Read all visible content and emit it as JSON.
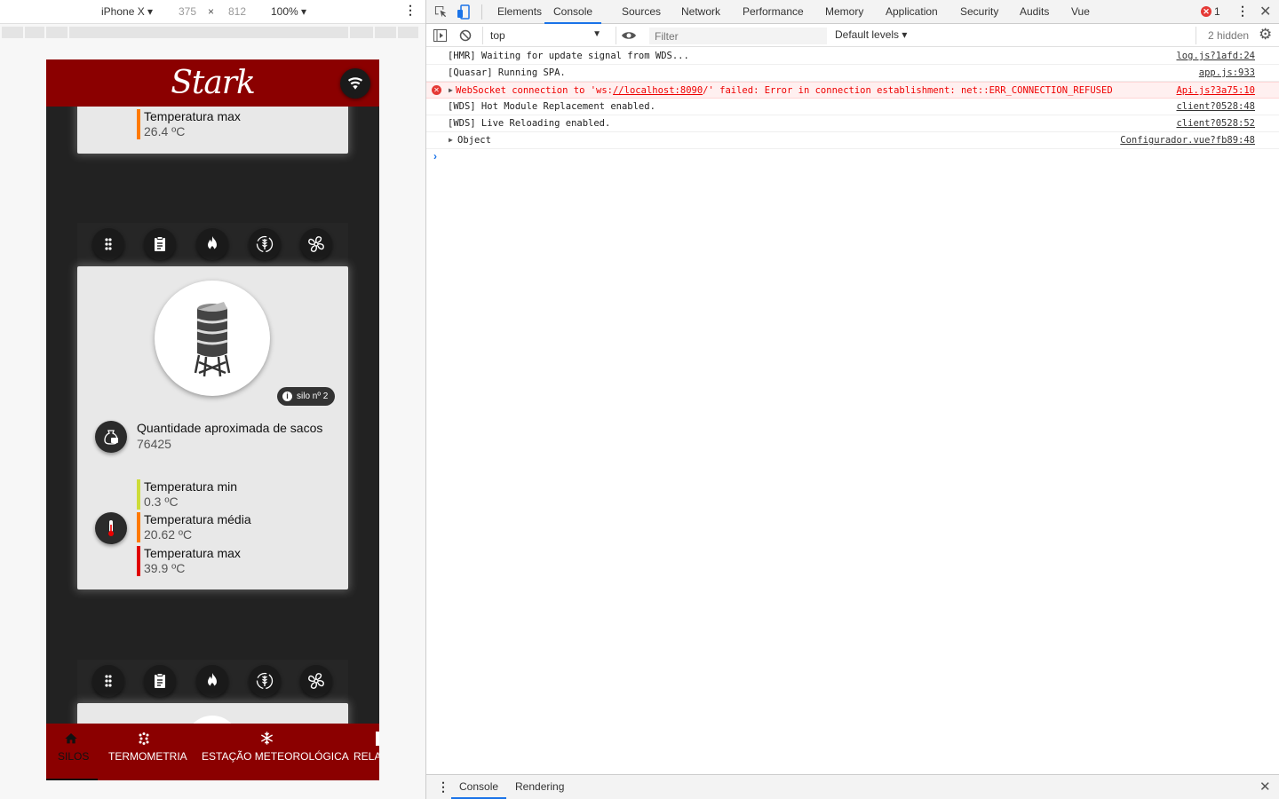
{
  "device_toolbar": {
    "device": "iPhone X",
    "width": "375",
    "times": "×",
    "height": "812",
    "zoom": "100%"
  },
  "app": {
    "logo": "Stark",
    "cards": [
      {
        "temperatures": [
          {
            "label": "Temperatura max",
            "value": "26.4 ºC",
            "color": "#ff7a00"
          }
        ]
      },
      {
        "badge": "silo nº 2",
        "bags_label": "Quantidade aproximada de sacos",
        "bags_value": "76425",
        "temperatures": [
          {
            "label": "Temperatura min",
            "value": "0.3 ºC",
            "color": "#cddc39"
          },
          {
            "label": "Temperatura média",
            "value": "20.62 ºC",
            "color": "#ff7a00"
          },
          {
            "label": "Temperatura max",
            "value": "39.9 ºC",
            "color": "#e00000"
          }
        ]
      }
    ],
    "bottom_nav": [
      {
        "label": "SILOS",
        "icon": "home-icon",
        "active": true
      },
      {
        "label": "TERMOMETRIA",
        "icon": "dots-icon"
      },
      {
        "label": "ESTAÇÃO METEOROLÓGICA",
        "icon": "snowflake-icon"
      },
      {
        "label": "RELAT",
        "icon": "report-icon"
      }
    ]
  },
  "devtools": {
    "tabs": [
      "Elements",
      "Console",
      "Sources",
      "Network",
      "Performance",
      "Memory",
      "Application",
      "Security",
      "Audits",
      "Vue"
    ],
    "active_tab": "Console",
    "error_count": "1",
    "context": "top",
    "filter_placeholder": "Filter",
    "levels": "Default levels",
    "hidden": "2 hidden",
    "messages": [
      {
        "text": "[HMR] Waiting for update signal from WDS...",
        "source": "log.js?1afd:24",
        "level": "log"
      },
      {
        "text": "[Quasar] Running SPA.",
        "source": "app.js:933",
        "level": "log"
      },
      {
        "text_prefix": "WebSocket connection to 'ws:",
        "text_link": "//localhost:8090",
        "text_suffix": "/' failed: Error in connection establishment: net::ERR_CONNECTION_REFUSED",
        "source": "Api.js?3a75:10",
        "level": "error"
      },
      {
        "text": "[WDS] Hot Module Replacement enabled.",
        "source": "client?0528:48",
        "level": "log"
      },
      {
        "text": "[WDS] Live Reloading enabled.",
        "source": "client?0528:52",
        "level": "log"
      },
      {
        "text": "Object",
        "source": "Configurador.vue?fb89:48",
        "level": "log"
      }
    ],
    "drawer_tabs": [
      "Console",
      "Rendering"
    ]
  },
  "colors": {
    "brand_red": "#8b0000",
    "devtools_accent": "#1a73e8",
    "error_red": "#e00000"
  }
}
